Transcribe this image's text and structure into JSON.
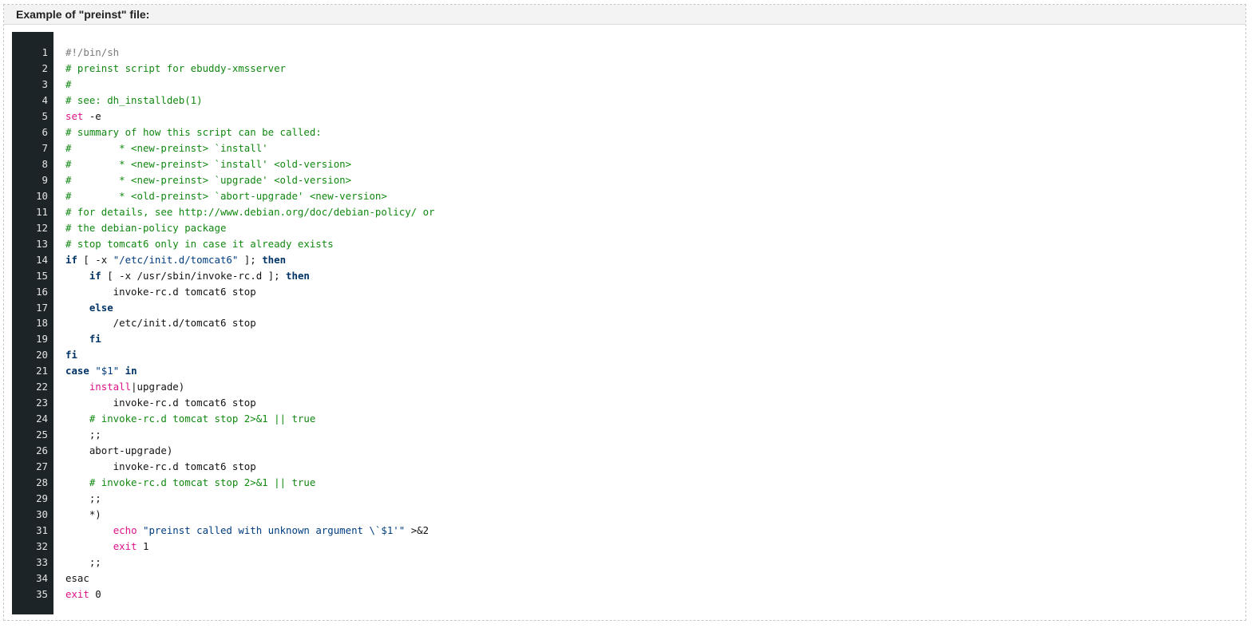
{
  "panel": {
    "title": "Example of \"preinst\" file:"
  },
  "colors": {
    "gutter_bg": "#1d2427",
    "comment": "#118811",
    "builtin": "#dd1188",
    "keyword": "#003366",
    "string": "#003d80"
  },
  "code": {
    "language": "shell",
    "lines": [
      {
        "num": "1",
        "tokens": [
          {
            "t": "#!/bin/sh",
            "k": "shebang"
          }
        ]
      },
      {
        "num": "2",
        "tokens": [
          {
            "t": "# preinst script for ebuddy-xmsserver",
            "k": "comment"
          }
        ]
      },
      {
        "num": "3",
        "tokens": [
          {
            "t": "#",
            "k": "comment"
          }
        ]
      },
      {
        "num": "4",
        "tokens": [
          {
            "t": "# see: dh_installdeb(1)",
            "k": "comment"
          }
        ]
      },
      {
        "num": "5",
        "tokens": [
          {
            "t": "set",
            "k": "builtin"
          },
          {
            "t": " -e",
            "k": "text"
          }
        ]
      },
      {
        "num": "6",
        "tokens": [
          {
            "t": "# summary of how this script can be called:",
            "k": "comment"
          }
        ]
      },
      {
        "num": "7",
        "tokens": [
          {
            "t": "#        * <new-preinst> `install'",
            "k": "comment"
          }
        ]
      },
      {
        "num": "8",
        "tokens": [
          {
            "t": "#        * <new-preinst> `install' <old-version>",
            "k": "comment"
          }
        ]
      },
      {
        "num": "9",
        "tokens": [
          {
            "t": "#        * <new-preinst> `upgrade' <old-version>",
            "k": "comment"
          }
        ]
      },
      {
        "num": "10",
        "tokens": [
          {
            "t": "#        * <old-preinst> `abort-upgrade' <new-version>",
            "k": "comment"
          }
        ]
      },
      {
        "num": "11",
        "tokens": [
          {
            "t": "# for details, see http://www.debian.org/doc/debian-policy/ or",
            "k": "comment"
          }
        ]
      },
      {
        "num": "12",
        "tokens": [
          {
            "t": "# the debian-policy package",
            "k": "comment"
          }
        ]
      },
      {
        "num": "13",
        "tokens": [
          {
            "t": "# stop tomcat6 only in case it already exists",
            "k": "comment"
          }
        ]
      },
      {
        "num": "14",
        "tokens": [
          {
            "t": "if",
            "k": "keyword"
          },
          {
            "t": " [ -x ",
            "k": "text"
          },
          {
            "t": "\"/etc/init.d/tomcat6\"",
            "k": "string"
          },
          {
            "t": " ]; ",
            "k": "text"
          },
          {
            "t": "then",
            "k": "keyword"
          }
        ]
      },
      {
        "num": "15",
        "tokens": [
          {
            "t": "    ",
            "k": "text"
          },
          {
            "t": "if",
            "k": "keyword"
          },
          {
            "t": " [ -x /usr/sbin/invoke-rc.d ]; ",
            "k": "text"
          },
          {
            "t": "then",
            "k": "keyword"
          }
        ]
      },
      {
        "num": "16",
        "tokens": [
          {
            "t": "        invoke-rc.d tomcat6 stop",
            "k": "text"
          }
        ]
      },
      {
        "num": "17",
        "tokens": [
          {
            "t": "    ",
            "k": "text"
          },
          {
            "t": "else",
            "k": "keyword"
          }
        ]
      },
      {
        "num": "18",
        "tokens": [
          {
            "t": "        /etc/init.d/tomcat6 stop",
            "k": "text"
          }
        ]
      },
      {
        "num": "19",
        "tokens": [
          {
            "t": "    ",
            "k": "text"
          },
          {
            "t": "fi",
            "k": "keyword"
          }
        ]
      },
      {
        "num": "20",
        "tokens": [
          {
            "t": "fi",
            "k": "keyword"
          }
        ]
      },
      {
        "num": "21",
        "tokens": [
          {
            "t": "case",
            "k": "keyword"
          },
          {
            "t": " ",
            "k": "text"
          },
          {
            "t": "\"$1\"",
            "k": "string"
          },
          {
            "t": " ",
            "k": "text"
          },
          {
            "t": "in",
            "k": "keyword"
          }
        ]
      },
      {
        "num": "22",
        "tokens": [
          {
            "t": "    ",
            "k": "text"
          },
          {
            "t": "install",
            "k": "builtin"
          },
          {
            "t": "|upgrade)",
            "k": "text"
          }
        ]
      },
      {
        "num": "23",
        "tokens": [
          {
            "t": "        invoke-rc.d tomcat6 stop",
            "k": "text"
          }
        ]
      },
      {
        "num": "24",
        "tokens": [
          {
            "t": "    ",
            "k": "text"
          },
          {
            "t": "# invoke-rc.d tomcat stop 2>&1 || true",
            "k": "comment"
          }
        ]
      },
      {
        "num": "25",
        "tokens": [
          {
            "t": "    ;;",
            "k": "text"
          }
        ]
      },
      {
        "num": "26",
        "tokens": [
          {
            "t": "    abort-upgrade)",
            "k": "text"
          }
        ]
      },
      {
        "num": "27",
        "tokens": [
          {
            "t": "        invoke-rc.d tomcat6 stop",
            "k": "text"
          }
        ]
      },
      {
        "num": "28",
        "tokens": [
          {
            "t": "    ",
            "k": "text"
          },
          {
            "t": "# invoke-rc.d tomcat stop 2>&1 || true",
            "k": "comment"
          }
        ]
      },
      {
        "num": "29",
        "tokens": [
          {
            "t": "    ;;",
            "k": "text"
          }
        ]
      },
      {
        "num": "30",
        "tokens": [
          {
            "t": "    *)",
            "k": "text"
          }
        ]
      },
      {
        "num": "31",
        "tokens": [
          {
            "t": "        ",
            "k": "text"
          },
          {
            "t": "echo",
            "k": "builtin"
          },
          {
            "t": " ",
            "k": "text"
          },
          {
            "t": "\"preinst called with unknown argument \\`$1'\"",
            "k": "string"
          },
          {
            "t": " >&2",
            "k": "text"
          }
        ]
      },
      {
        "num": "32",
        "tokens": [
          {
            "t": "        ",
            "k": "text"
          },
          {
            "t": "exit",
            "k": "builtin"
          },
          {
            "t": " 1",
            "k": "text"
          }
        ]
      },
      {
        "num": "33",
        "tokens": [
          {
            "t": "    ;;",
            "k": "text"
          }
        ]
      },
      {
        "num": "34",
        "tokens": [
          {
            "t": "esac",
            "k": "text"
          }
        ]
      },
      {
        "num": "35",
        "tokens": [
          {
            "t": "exit",
            "k": "builtin"
          },
          {
            "t": " 0",
            "k": "text"
          }
        ]
      }
    ]
  }
}
